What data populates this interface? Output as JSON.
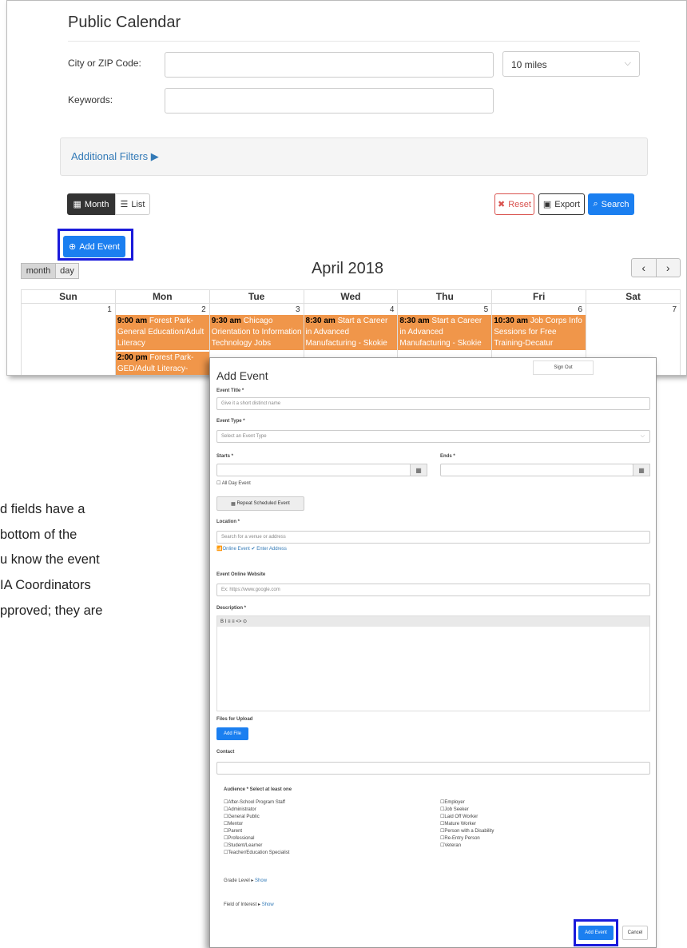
{
  "calendar": {
    "title": "Public Calendar",
    "city_label": "City or ZIP Code:",
    "distance_value": "10 miles",
    "keywords_label": "Keywords:",
    "additional_filters": "Additional Filters",
    "month_btn": "Month",
    "list_btn": "List",
    "reset_btn": "Reset",
    "export_btn": "Export",
    "search_btn": "Search",
    "add_event_btn": "Add Event",
    "view_month": "month",
    "view_day": "day",
    "month_title": "April 2018",
    "weekdays": [
      "Sun",
      "Mon",
      "Tue",
      "Wed",
      "Thu",
      "Fri",
      "Sat"
    ],
    "day_numbers": [
      "1",
      "2",
      "3",
      "4",
      "5",
      "6",
      "7"
    ],
    "events": {
      "mon_1_time": "9:00 am",
      "mon_1_title": "Forest Park-General Education/Adult Literacy",
      "mon_2_time": "2:00 pm",
      "mon_2_title": "Forest Park-GED/Adult Literacy-",
      "tue_1_time": "9:30 am",
      "tue_1_title": "Chicago Orientation to Information Technology Jobs",
      "wed_1_time": "8:30 am",
      "wed_1_title": "Start a Career in Advanced Manufacturing - Skokie",
      "thu_1_time": "8:30 am",
      "thu_1_title": "Start a Career in Advanced Manufacturing - Skokie",
      "fri_1_time": "10:30 am",
      "fri_1_title": "Job Corps Info Sessions for Free Training-Decatur"
    }
  },
  "add_event": {
    "title": "Add Event",
    "sage_chip": "Sign Out",
    "event_title_label": "Event Title *",
    "event_title_placeholder": "Give it a short distinct name",
    "event_type_label": "Event Type *",
    "event_type_placeholder": "Select an Event Type",
    "starts_label": "Starts *",
    "ends_label": "Ends *",
    "all_day": "All Day Event",
    "repeat_btn": "Repeat Scheduled Event",
    "location_label": "Location *",
    "location_placeholder": "Search for a venue or address",
    "location_links": "Online Event  ✔ Enter Address",
    "website_label": "Event Online Website",
    "website_placeholder": "Ex: https://www.google.com",
    "description_label": "Description *",
    "editor_toolbar": "B  I      ≡  ≡   <> ⊙",
    "files_label": "Files for Upload",
    "add_file_btn": "Add File",
    "contact_label": "Contact",
    "audience_label": "Audience * Select at least one",
    "audience_left": [
      "After-School Program Staff",
      "Administrator",
      "General Public",
      "Mentor",
      "Parent",
      "Professional",
      "Student/Learner",
      "Teacher/Education Specialist"
    ],
    "audience_right": [
      "Employer",
      "Job Seeker",
      "Laid Off Worker",
      "Mature Worker",
      "Person with a Disability",
      "Re-Entry Person",
      "Veteran"
    ],
    "grade_level": "Grade Level ▸",
    "grade_show": "Show",
    "field_interest": "Field of Interest ▸",
    "field_show": "Show",
    "submit_btn": "Add Event",
    "cancel_btn": "Cancel"
  },
  "background_text": [
    "d fields have a",
    "bottom of the",
    "u know the event",
    "IA Coordinators",
    "pproved; they are"
  ]
}
